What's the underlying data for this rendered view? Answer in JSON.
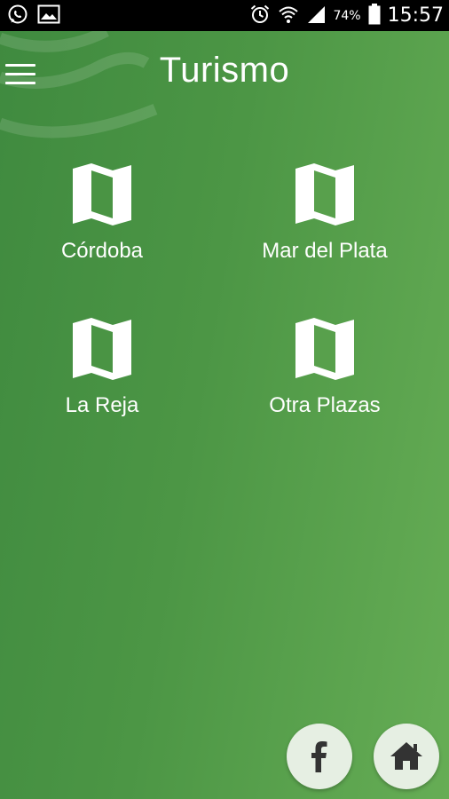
{
  "status_bar": {
    "icons_left": [
      "whatsapp-icon",
      "image-icon"
    ],
    "icons_right": [
      "alarm-icon",
      "wifi-icon",
      "signal-icon",
      "battery-icon"
    ],
    "battery": "74%",
    "time": "15:57"
  },
  "app_bar": {
    "menu_icon": "hamburger-menu-icon",
    "title": "Turismo"
  },
  "destinations": [
    {
      "label": "Córdoba",
      "icon": "map-icon"
    },
    {
      "label": "Mar del Plata",
      "icon": "map-icon"
    },
    {
      "label": "La Reja",
      "icon": "map-icon"
    },
    {
      "label": "Otra Plazas",
      "icon": "map-icon"
    }
  ],
  "floating_buttons": [
    {
      "icon": "facebook-icon"
    },
    {
      "icon": "home-icon"
    }
  ],
  "colors": {
    "background_start": "#3f8a3f",
    "background_end": "#66ad55",
    "status_bar": "#000000",
    "fab_background": "#e6efe3",
    "fab_icon": "#333333"
  }
}
